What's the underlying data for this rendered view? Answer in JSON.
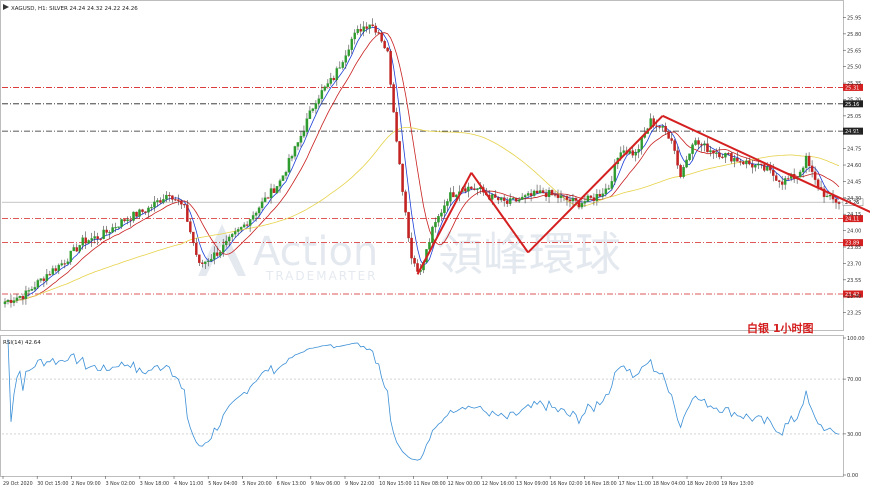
{
  "chart_data": [
    {
      "type": "candlestick",
      "header": "XAGUSD, H1: SILVER 24.24 24.32 24.22 24.26",
      "symbol": "XAGUSD",
      "timeframe": "H1",
      "annotation": "白银  1小时图",
      "watermark": {
        "latin": "Action",
        "cjk": "領峰環球",
        "sub": "TRADEMARTER"
      },
      "ylim": [
        23.1,
        26.0
      ],
      "price_ticks": [
        "25.95",
        "25.80",
        "25.65",
        "25.50",
        "25.35",
        "25.20",
        "25.05",
        "24.90",
        "24.75",
        "24.60",
        "24.45",
        "24.30",
        "24.15",
        "24.00",
        "23.85",
        "23.70",
        "23.55",
        "23.40",
        "23.25"
      ],
      "price_tick_values": [
        25.95,
        25.8,
        25.65,
        25.5,
        25.35,
        25.2,
        25.05,
        24.9,
        24.75,
        24.6,
        24.45,
        24.3,
        24.15,
        24.0,
        23.85,
        23.7,
        23.55,
        23.4,
        23.25
      ],
      "last_price": {
        "label": "24.26",
        "value": 24.26
      },
      "levels": [
        {
          "label": "25.31",
          "value": 25.31,
          "style": "dashdot",
          "color": "#d42020"
        },
        {
          "label": "25.16",
          "value": 25.16,
          "style": "dashdot",
          "color": "#222222"
        },
        {
          "label": "24.91",
          "value": 24.91,
          "style": "dashdot",
          "color": "#222222"
        },
        {
          "label": "24.11",
          "value": 24.11,
          "style": "dashdot",
          "color": "#d42020"
        },
        {
          "label": "23.89",
          "value": 23.89,
          "style": "dashdot",
          "color": "#d42020"
        },
        {
          "label": "23.42",
          "value": 23.42,
          "style": "dashdot",
          "color": "#d42020"
        }
      ],
      "x_labels": [
        "29 Oct 2020",
        "30 Oct 15:00",
        "2 Nov 09:00",
        "3 Nov 02:00",
        "3 Nov 18:00",
        "4 Nov 11:00",
        "5 Nov 04:00",
        "5 Nov 20:00",
        "6 Nov 13:00",
        "9 Nov 06:00",
        "9 Nov 22:00",
        "10 Nov 15:00",
        "11 Nov 08:00",
        "12 Nov 00:00",
        "12 Nov 16:00",
        "13 Nov 09:00",
        "16 Nov 02:00",
        "16 Nov 18:00",
        "17 Nov 11:00",
        "18 Nov 04:00",
        "18 Nov 20:00",
        "19 Nov 13:00"
      ],
      "price_path": [
        [
          0,
          23.35
        ],
        [
          7,
          23.42
        ],
        [
          14,
          23.6
        ],
        [
          20,
          23.72
        ],
        [
          26,
          23.9
        ],
        [
          32,
          23.95
        ],
        [
          40,
          24.1
        ],
        [
          48,
          24.2
        ],
        [
          55,
          24.35
        ],
        [
          60,
          24.2
        ],
        [
          65,
          23.68
        ],
        [
          72,
          23.82
        ],
        [
          80,
          24.05
        ],
        [
          86,
          24.25
        ],
        [
          92,
          24.45
        ],
        [
          98,
          24.8
        ],
        [
          104,
          25.2
        ],
        [
          110,
          25.4
        ],
        [
          116,
          25.75
        ],
        [
          119,
          25.85
        ],
        [
          122,
          25.9
        ],
        [
          125,
          25.82
        ],
        [
          128,
          25.62
        ],
        [
          132,
          24.6
        ],
        [
          136,
          23.75
        ],
        [
          139,
          23.62
        ],
        [
          143,
          24.0
        ],
        [
          148,
          24.3
        ],
        [
          153,
          24.4
        ],
        [
          158,
          24.38
        ],
        [
          163,
          24.3
        ],
        [
          168,
          24.25
        ],
        [
          174,
          24.3
        ],
        [
          180,
          24.35
        ],
        [
          186,
          24.3
        ],
        [
          192,
          24.25
        ],
        [
          197,
          24.3
        ],
        [
          202,
          24.4
        ],
        [
          206,
          24.75
        ],
        [
          211,
          24.7
        ],
        [
          216,
          25.0
        ],
        [
          219,
          24.95
        ],
        [
          223,
          24.85
        ],
        [
          226,
          24.5
        ],
        [
          230,
          24.82
        ],
        [
          235,
          24.75
        ],
        [
          240,
          24.7
        ],
        [
          245,
          24.65
        ],
        [
          250,
          24.6
        ],
        [
          255,
          24.55
        ],
        [
          260,
          24.45
        ],
        [
          265,
          24.5
        ],
        [
          268,
          24.65
        ],
        [
          271,
          24.45
        ],
        [
          275,
          24.3
        ],
        [
          279,
          24.26
        ]
      ],
      "volatility": 0.035,
      "trend_lines": [
        {
          "points": [
            [
              138,
              23.6
            ],
            [
              156,
              24.53
            ]
          ]
        },
        {
          "points": [
            [
              156,
              24.53
            ],
            [
              175,
              23.8
            ]
          ]
        },
        {
          "points": [
            [
              175,
              23.8
            ],
            [
              220,
              25.05
            ]
          ]
        },
        {
          "points": [
            [
              220,
              25.05
            ],
            [
              295,
              24.1
            ]
          ]
        },
        {
          "points": [
            [
              295,
              24.1
            ],
            [
              303,
              24.56
            ]
          ],
          "arrow": true
        }
      ],
      "rsi": {
        "label": "RSI(14) 42.64",
        "value": 42.64,
        "ylim": [
          0,
          100
        ],
        "ticks": [
          "100.00",
          "70.00",
          "30.00",
          "0.00"
        ],
        "tick_values": [
          100,
          70,
          30,
          0
        ],
        "levels": [
          70,
          30
        ]
      }
    }
  ]
}
